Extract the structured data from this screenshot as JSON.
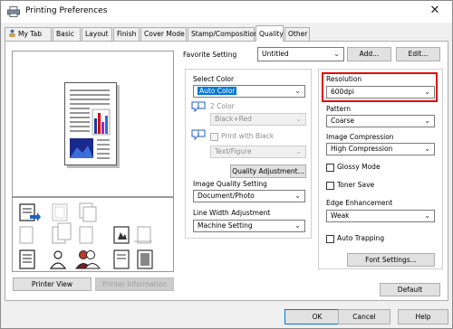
{
  "window": {
    "title": "Printing Preferences",
    "close_glyph": "✕"
  },
  "tabs": [
    {
      "label": "My Tab",
      "active": false
    },
    {
      "label": "Basic",
      "active": false
    },
    {
      "label": "Layout",
      "active": false
    },
    {
      "label": "Finish",
      "active": false
    },
    {
      "label": "Cover Mode",
      "active": false
    },
    {
      "label": "Stamp/Composition",
      "active": false
    },
    {
      "label": "Quality",
      "active": true
    },
    {
      "label": "Other",
      "active": false
    }
  ],
  "favorite": {
    "label": "Favorite Setting",
    "value": "Untitled",
    "add_label": "Add...",
    "edit_label": "Edit..."
  },
  "left_buttons": {
    "printer_view": "Printer View",
    "printer_information": "Printer Information"
  },
  "quality": {
    "select_color_label": "Select Color",
    "select_color_value": "Auto Color",
    "two_color_label": "2 Color",
    "two_color_value": "Black+Red",
    "print_with_black_label": "Print with Black",
    "text_figure_value": "Text/Figure",
    "quality_adjustment_label": "Quality Adjustment...",
    "image_quality_label": "Image Quality Setting",
    "image_quality_value": "Document/Photo",
    "line_width_label": "Line Width Adjustment",
    "line_width_value": "Machine Setting"
  },
  "right_panel": {
    "resolution_label": "Resolution",
    "resolution_value": "600dpi",
    "pattern_label": "Pattern",
    "pattern_value": "Coarse",
    "image_compression_label": "Image Compression",
    "image_compression_value": "High Compression",
    "glossy_mode_label": "Glossy Mode",
    "toner_save_label": "Toner Save",
    "edge_enhancement_label": "Edge Enhancement",
    "edge_enhancement_value": "Weak",
    "auto_trapping_label": "Auto Trapping",
    "font_settings_label": "Font Settings..."
  },
  "default_label": "Default",
  "footer": {
    "ok": "OK",
    "cancel": "Cancel",
    "help": "Help"
  },
  "colors": {
    "highlight_box": "#e00000",
    "selection_blue": "#0078d7",
    "dialog_bg": "#f0f0f0"
  },
  "icons": [
    "printer-icon",
    "profile-icon",
    "info-icon",
    "chevron-down-icon",
    "page-preview-icon",
    "status-icons"
  ]
}
